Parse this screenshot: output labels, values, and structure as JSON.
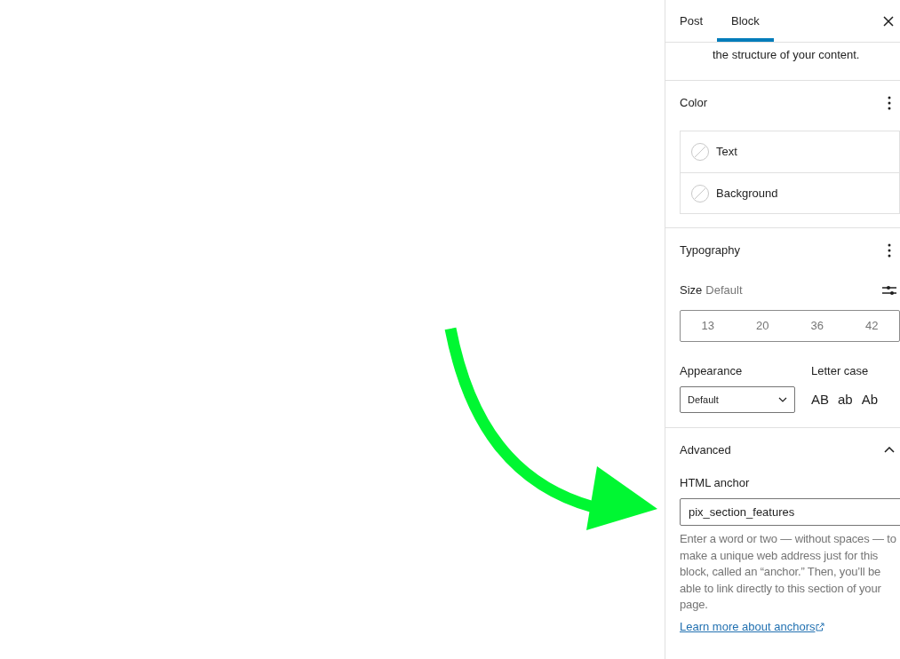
{
  "tabs": [
    {
      "label": "Post",
      "selected": false
    },
    {
      "label": "Block",
      "selected": true
    }
  ],
  "description_tail": "the structure of your content.",
  "panels": [
    {
      "kind": "color",
      "title": "Color",
      "items": [
        {
          "label": "Text"
        },
        {
          "label": "Background"
        }
      ]
    },
    {
      "kind": "typography",
      "title": "Typography",
      "size_label": "Size",
      "size_value": "Default",
      "sizes": [
        {
          "label": "13",
          "selected": false
        },
        {
          "label": "20",
          "selected": false
        },
        {
          "label": "36",
          "selected": false
        },
        {
          "label": "42",
          "selected": false
        }
      ],
      "appearance": {
        "label": "Appearance",
        "value": "Default"
      },
      "letter_case": {
        "label": "Letter case",
        "options": [
          {
            "label": "AB",
            "selected": false
          },
          {
            "label": "ab",
            "selected": false
          },
          {
            "label": "Ab",
            "selected": false
          }
        ]
      }
    },
    {
      "kind": "advanced",
      "title": "Advanced",
      "expanded": true,
      "anchor": {
        "label": "HTML anchor",
        "value": "pix_section_features"
      },
      "help": "Enter a word or two — without spaces — to make a unique web address just for this block, called an “anchor.” Then, you’ll be able to link directly to this section of your page.",
      "link": "Learn more about anchors"
    }
  ]
}
